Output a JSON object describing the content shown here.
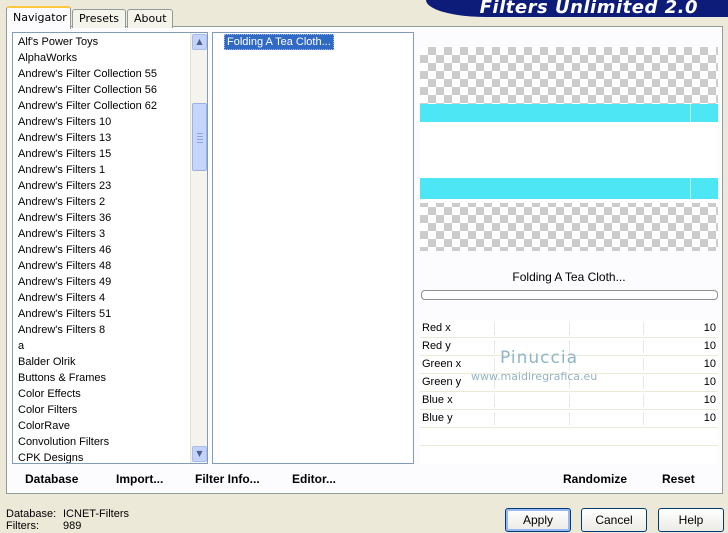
{
  "window": {
    "title": "Filters Unlimited 2.0"
  },
  "tabs": [
    {
      "label": "Navigator",
      "active": true
    },
    {
      "label": "Presets",
      "active": false
    },
    {
      "label": "About",
      "active": false
    }
  ],
  "categories": {
    "selected": "Andrew's Filters 3",
    "items": [
      "Alf's Power Toys",
      "AlphaWorks",
      "Andrew's Filter Collection 55",
      "Andrew's Filter Collection 56",
      "Andrew's Filter Collection 62",
      "Andrew's Filters 10",
      "Andrew's Filters 13",
      "Andrew's Filters 15",
      "Andrew's Filters 1",
      "Andrew's Filters 23",
      "Andrew's Filters 2",
      "Andrew's Filters 36",
      "Andrew's Filters 3",
      "Andrew's Filters 46",
      "Andrew's Filters 48",
      "Andrew's Filters 49",
      "Andrew's Filters 4",
      "Andrew's Filters 51",
      "Andrew's Filters 8",
      "a",
      "Balder Olrik",
      "Buttons & Frames",
      "Color Effects",
      "Color Filters",
      "ColorRave",
      "Convolution Filters",
      "CPK Designs"
    ]
  },
  "filters": {
    "items": [
      "Folding A Tea Cloth..."
    ],
    "selected": "Folding A Tea Cloth..."
  },
  "preview": {
    "filter_name": "Folding A Tea Cloth...",
    "progress": 0
  },
  "params": [
    {
      "label": "Red x",
      "value": "10"
    },
    {
      "label": "Red y",
      "value": "10"
    },
    {
      "label": "Green x",
      "value": "10"
    },
    {
      "label": "Green y",
      "value": "10"
    },
    {
      "label": "Blue x",
      "value": "10"
    },
    {
      "label": "Blue y",
      "value": "10"
    }
  ],
  "watermark": {
    "line1": "Pinuccia",
    "line2": "www.maidiregrafica.eu"
  },
  "toolbar": {
    "database": "Database",
    "import": "Import...",
    "filter_info": "Filter Info...",
    "editor": "Editor...",
    "randomize": "Randomize",
    "reset": "Reset"
  },
  "status": {
    "database_label": "Database:",
    "database_value": "ICNET-Filters",
    "filters_label": "Filters:",
    "filters_value": "989"
  },
  "buttons": {
    "apply": "Apply",
    "cancel": "Cancel",
    "help": "Help"
  },
  "colors": {
    "selection": "#316AC5",
    "preview_band": "#4DE6F5",
    "banner": "#0C1C78"
  }
}
